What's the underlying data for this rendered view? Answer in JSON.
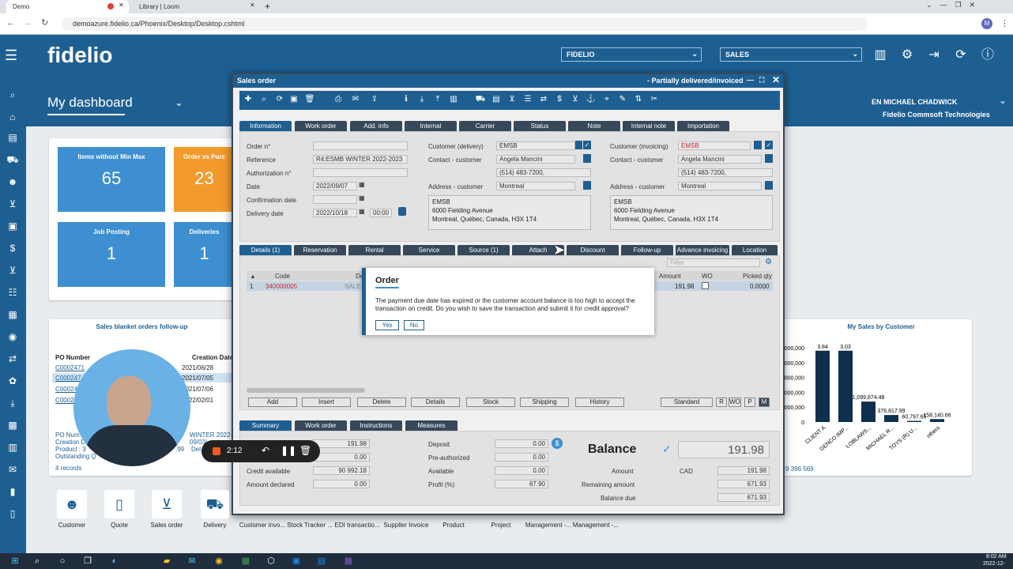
{
  "browser": {
    "tab1": "Demo",
    "tab2": "Library | Loom",
    "url": "demoazure.fidelio.ca/Phoenix/Desktop/Desktop.cshtml"
  },
  "app": {
    "logo": "fidelio",
    "company_select": "FIDELIO",
    "module_select": "SALES",
    "user": "EN MICHAEL CHADWICK",
    "company": "Fidelio Commsoft Technologies",
    "dashboard_title": "My dashboard"
  },
  "tiles": [
    {
      "title": "Items without Min Max",
      "value": "65"
    },
    {
      "title": "Order vs Purc",
      "value": "23"
    },
    {
      "title": "Job Posting",
      "value": "1"
    },
    {
      "title": "Deliveries",
      "value": "1"
    }
  ],
  "blanket": {
    "title": "Sales blanket orders follow-up",
    "col1": "PO Number",
    "col2": "Creation Date",
    "rows": [
      {
        "po": "C0002471",
        "date": "2021/06/28"
      },
      {
        "po": "C000247",
        "date": "2021/07/05"
      },
      {
        "po": "C00024",
        "date": "2021/07/06"
      },
      {
        "po": "C00024",
        "date": "2022/02/01"
      }
    ],
    "po_num": "PO Num",
    "creation": "Creation D",
    "product": "Product : 3",
    "outstanding": "Outstanding Q",
    "winter": "WINTER 2022-",
    "date2": "09/03/",
    "val99": ".99",
    "del": "Del",
    "records": "4 records"
  },
  "salesbycustomer": {
    "title": "My Sales by Customer",
    "total": "9 396 569"
  },
  "chart_data": {
    "type": "bar",
    "title": "My Sales by Customer",
    "categories": [
      "CLIENT A",
      "GENCO IMP...",
      "LOBLAWS...",
      "MICHAEL R...",
      "TOYS (R) U...",
      "others"
    ],
    "values": [
      3840000,
      3840000,
      1099874.48,
      376817.99,
      60797.65,
      158140.66
    ],
    "data_labels": [
      "3.84",
      "3.03",
      "1,099,874.48",
      "376,817.99",
      "60,797.65",
      "158,140.66"
    ],
    "ytick_labels": [
      "000,000",
      "000,000",
      "000,000",
      "000,000",
      "000,000",
      "0"
    ]
  },
  "window": {
    "title": "Sales order",
    "status": "- Partially delivered/invoiced"
  },
  "top_tabs": [
    "Information",
    "Work order",
    "Add. info",
    "Internal",
    "Carrier",
    "Status",
    "Note",
    "Internal note",
    "Importation"
  ],
  "info": {
    "order_lbl": "Order n°",
    "ref_lbl": "Reference",
    "ref_val": "R4:ESMB WINTER 2022-2023",
    "auth_lbl": "Authorization n°",
    "date_lbl": "Date",
    "date_val": "2022/09/07",
    "conf_lbl": "Confirmation date",
    "deliv_lbl": "Delivery date",
    "deliv_val": "2022/10/18",
    "deliv_time": "00:00",
    "cust_del_lbl": "Customer (delivery)",
    "cust_del_val": "EMSB",
    "contact_lbl": "Contact - customer",
    "contact_val": "Angela Mancini",
    "phone": "(514) 483-7200,",
    "addr_lbl": "Address - customer",
    "addr_val": "Montreal",
    "address_block": [
      "EMSB",
      "6000 Fielding Avenue",
      "Montreal, Québec, Canada, H3X 1T4"
    ],
    "cust_inv_lbl": "Customer (invoicing)",
    "cust_inv_val": "EMSB"
  },
  "detail_tabs": [
    "Details (1)",
    "Reservation",
    "Rental",
    "Service",
    "Source (1)",
    "Attach",
    "Discount",
    "Follow-up",
    "Advance invoicing",
    "Location"
  ],
  "grid": {
    "filter": "Filter",
    "code_col": "Code",
    "de_col": "De",
    "amount_col": "Amount",
    "wo_col": "WO",
    "picked_col": "Picked qty",
    "row_num": "1",
    "row_code": "340000005",
    "row_de": "SALE",
    "row_amount": "191.98",
    "row_picked": "0.0000"
  },
  "grid_buttons": [
    "Add",
    "Insert",
    "Delete",
    "Details",
    "Stock",
    "Shipping",
    "History"
  ],
  "mode_buttons": [
    "Standard",
    "R",
    "WO",
    "P",
    "M"
  ],
  "bottom_tabs": [
    "Summary",
    "Work order",
    "Instructions",
    "Measures"
  ],
  "summary": {
    "v1": "191.98",
    "v2": "0.00",
    "credit_lbl": "Credit available",
    "credit_val": "90 992.18",
    "declared_lbl": "Amount declared",
    "declared_val": "0.00",
    "deposit_lbl": "Deposit",
    "deposit_val": "0.00",
    "preauth_lbl": "Pre-authorized",
    "preauth_val": "0.00",
    "available_lbl": "Available",
    "available_val": "0.00",
    "profit_lbl": "Profit (%)",
    "profit_val": "67.90",
    "balance_lbl": "Balance",
    "balance_val": "191.98",
    "amount_lbl": "Amount",
    "currency": "CAD",
    "amount_val": "191.98",
    "remaining_lbl": "Remaining amount",
    "remaining_val": "671.93",
    "baldue_lbl": "Balance due",
    "baldue_val": "671.93"
  },
  "dialog": {
    "title": "Order",
    "message": "The payment due date has expired or the customer account balance is too high to accept the transaction on credit. Do you wish to save the transaction and submit it for credit approval?",
    "yes": "Yes",
    "no": "No"
  },
  "recorder": {
    "time": "2:12"
  },
  "bottom_apps": [
    "Customer",
    "Quote",
    "Sales order",
    "Delivery",
    "Customer invo...",
    "Stock Tracker ...",
    "EDI transactio...",
    "Supplier Invoice",
    "Product",
    "Project",
    "Management -...",
    "Management -..."
  ],
  "taskbar": {
    "time": "8:02 AM",
    "date": "2022-12-"
  }
}
